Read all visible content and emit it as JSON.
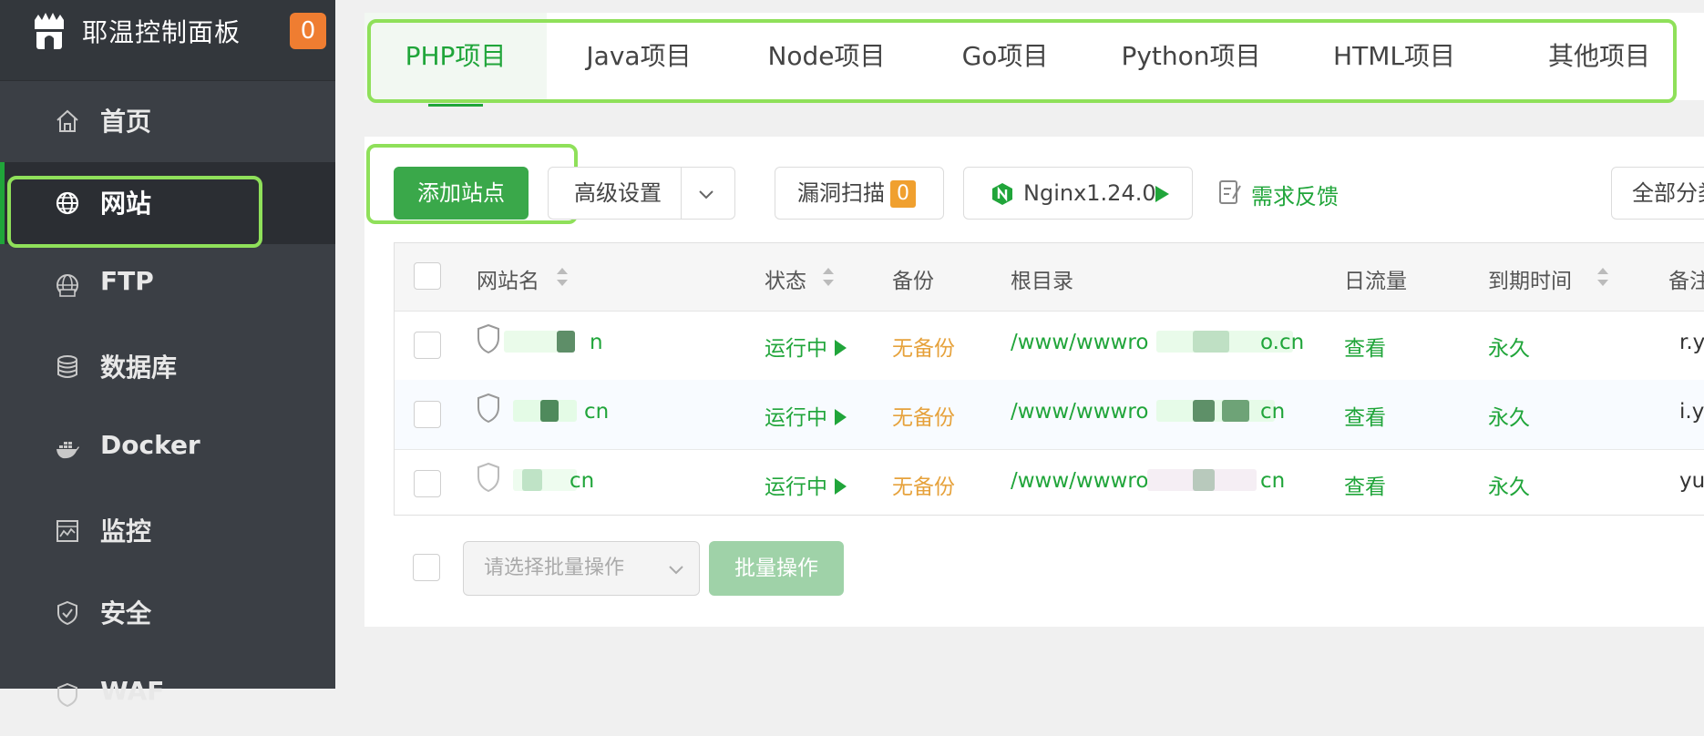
{
  "brand": {
    "title": "耶温控制面板",
    "badge": "0"
  },
  "sidebar": {
    "items": [
      {
        "label": "首页",
        "icon": "home-icon"
      },
      {
        "label": "网站",
        "icon": "globe-icon",
        "active": true
      },
      {
        "label": "FTP",
        "icon": "ftp-icon"
      },
      {
        "label": "数据库",
        "icon": "database-icon"
      },
      {
        "label": "Docker",
        "icon": "docker-icon"
      },
      {
        "label": "监控",
        "icon": "monitor-icon"
      },
      {
        "label": "安全",
        "icon": "shield-icon"
      },
      {
        "label": "WAF",
        "icon": "waf-icon"
      }
    ]
  },
  "tabs": [
    {
      "label": "PHP项目",
      "active": true
    },
    {
      "label": "Java项目"
    },
    {
      "label": "Node项目"
    },
    {
      "label": "Go项目"
    },
    {
      "label": "Python项目"
    },
    {
      "label": "HTML项目"
    },
    {
      "label": "其他项目"
    }
  ],
  "toolbar": {
    "add_site": "添加站点",
    "advanced": "高级设置",
    "scan": "漏洞扫描",
    "scan_count": "0",
    "nginx": "Nginx1.24.0",
    "feedback": "需求反馈",
    "category": "全部分类"
  },
  "table": {
    "headers": [
      "网站名",
      "状态",
      "备份",
      "根目录",
      "日流量",
      "到期时间",
      "备注"
    ],
    "rows": [
      {
        "name_suffix": "n",
        "status": "运行中",
        "backup": "无备份",
        "root_prefix": "/www/wwwro",
        "root_suffix": "o.cn",
        "traffic": "查看",
        "expire": "永久",
        "note": "r.y"
      },
      {
        "name_suffix": "cn",
        "status": "运行中",
        "backup": "无备份",
        "root_prefix": "/www/wwwro",
        "root_suffix": "cn",
        "traffic": "查看",
        "expire": "永久",
        "note": "i.y"
      },
      {
        "name_suffix": "cn",
        "status": "运行中",
        "backup": "无备份",
        "root_prefix": "/www/wwwro",
        "root_suffix": "cn",
        "traffic": "查看",
        "expire": "永久",
        "note": "yu"
      }
    ]
  },
  "batch": {
    "placeholder": "请选择批量操作",
    "button": "批量操作"
  },
  "colors": {
    "accent": "#20a53a",
    "highlight": "#8fe05a",
    "warning": "#e6a23c",
    "sidebar": "#3b3f45"
  }
}
